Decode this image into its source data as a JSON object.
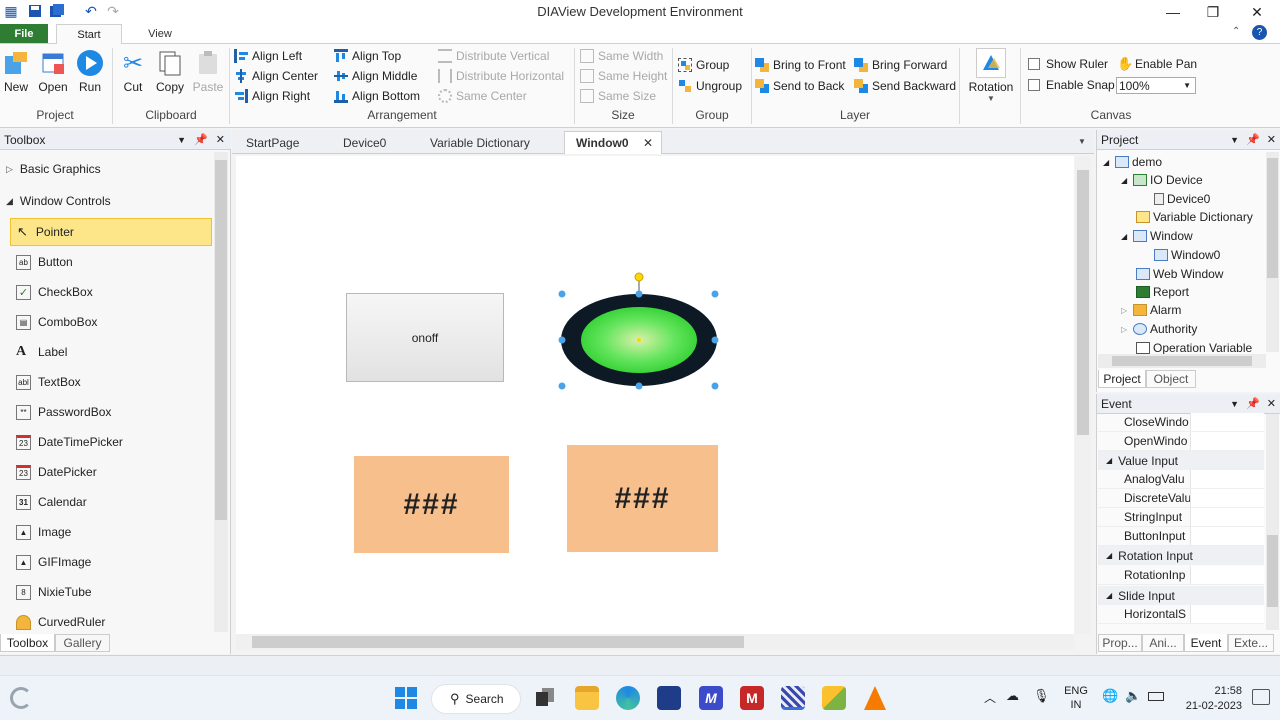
{
  "window": {
    "title": "DIAView Development Environment",
    "controls": {
      "minimize": "—",
      "maximize": "❐",
      "close": "✕"
    }
  },
  "ribbon_tabs": {
    "file": "File",
    "start": "Start",
    "view": "View"
  },
  "ribbon": {
    "project": {
      "label": "Project",
      "new": "New",
      "open": "Open",
      "run": "Run"
    },
    "clipboard": {
      "label": "Clipboard",
      "cut": "Cut",
      "copy": "Copy",
      "paste": "Paste"
    },
    "arrangement": {
      "label": "Arrangement",
      "align_left": "Align Left",
      "align_center": "Align Center",
      "align_right": "Align Right",
      "align_top": "Align Top",
      "align_middle": "Align Middle",
      "align_bottom": "Align Bottom",
      "distribute_vertical": "Distribute Vertical",
      "distribute_horizontal": "Distribute Horizontal",
      "same_center": "Same Center"
    },
    "size": {
      "label": "Size",
      "same_width": "Same Width",
      "same_height": "Same Height",
      "same_size": "Same Size"
    },
    "group": {
      "label": "Group",
      "group": "Group",
      "ungroup": "Ungroup"
    },
    "layer": {
      "label": "Layer",
      "bring_to_front": "Bring to Front",
      "send_to_back": "Send to Back",
      "bring_forward": "Bring Forward",
      "send_backward": "Send Backward"
    },
    "rotation": {
      "label": "Rotation"
    },
    "canvas": {
      "label": "Canvas",
      "show_ruler": "Show Ruler",
      "enable_snap": "Enable Snap",
      "enable_pan": "Enable Pan",
      "zoom": "100%"
    }
  },
  "toolbox": {
    "title": "Toolbox",
    "categories": [
      "Basic Graphics",
      "Window Controls"
    ],
    "items": [
      "Pointer",
      "Button",
      "CheckBox",
      "ComboBox",
      "Label",
      "TextBox",
      "PasswordBox",
      "DateTimePicker",
      "DatePicker",
      "Calendar",
      "Image",
      "GIFImage",
      "NixieTube",
      "CurvedRuler"
    ],
    "selected": "Pointer",
    "bottom_tabs": [
      "Toolbox",
      "Gallery"
    ]
  },
  "doc_tabs": [
    "StartPage",
    "Device0",
    "Variable Dictionary",
    "Window0"
  ],
  "active_doc_tab": "Window0",
  "canvas": {
    "button_label": "onoff",
    "display1": "###",
    "display2": "###"
  },
  "project_panel": {
    "title": "Project",
    "tree": [
      "demo",
      "IO Device",
      "Device0",
      "Variable Dictionary",
      "Window",
      "Window0",
      "Web Window",
      "Report",
      "Alarm",
      "Authority",
      "Operation Variable"
    ],
    "tabs": [
      "Project",
      "Object"
    ]
  },
  "event_panel": {
    "title": "Event",
    "rows": [
      {
        "type": "item",
        "name": "CloseWindo"
      },
      {
        "type": "item",
        "name": "OpenWindo"
      },
      {
        "type": "cat",
        "name": "Value Input"
      },
      {
        "type": "item",
        "name": "AnalogValu"
      },
      {
        "type": "item",
        "name": "DiscreteValu"
      },
      {
        "type": "item",
        "name": "StringInput"
      },
      {
        "type": "item",
        "name": "ButtonInput"
      },
      {
        "type": "cat",
        "name": "Rotation Input"
      },
      {
        "type": "item",
        "name": "RotationInp"
      },
      {
        "type": "cat",
        "name": "Slide Input"
      },
      {
        "type": "item",
        "name": "HorizontalS"
      }
    ],
    "tabs": [
      "Prop...",
      "Ani...",
      "Event",
      "Exte..."
    ]
  },
  "taskbar": {
    "search": "Search",
    "lang_top": "ENG",
    "lang_bottom": "IN",
    "time": "21:58",
    "date": "21-02-2023"
  },
  "colors": {
    "selection": "#fde68a",
    "display_fill": "#f7bf8c",
    "ellipse_outer": "#0d1a26",
    "ellipse_inner": "#3ddc3d",
    "file_tab": "#2e7d32"
  }
}
